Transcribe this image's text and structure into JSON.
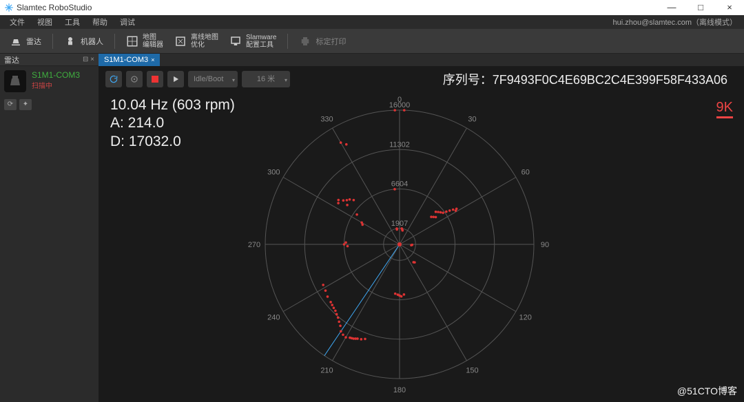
{
  "titlebar": {
    "title": "Slamtec RoboStudio"
  },
  "window_buttons": {
    "min": "—",
    "max": "□",
    "close": "×"
  },
  "menubar": {
    "items": [
      "文件",
      "视图",
      "工具",
      "帮助",
      "调试"
    ],
    "right": "hui.zhou@slamtec.com（离线模式）"
  },
  "toolbar": {
    "items": [
      {
        "icon": "radar-icon",
        "label": "雷达"
      },
      {
        "icon": "robot-icon",
        "label": "机器人"
      },
      {
        "icon": "map-editor-icon",
        "label1": "地图",
        "label2": "编辑器"
      },
      {
        "icon": "offline-map-icon",
        "label1": "离线地图",
        "label2": "优化"
      },
      {
        "icon": "slamware-icon",
        "label1": "Slamware",
        "label2": "配置工具"
      },
      {
        "icon": "print-icon",
        "label": "标定打印"
      }
    ]
  },
  "left": {
    "header": "雷达",
    "header_close": "⊟ ×",
    "device": {
      "name": "S1M1-COM3",
      "status": "扫描中"
    },
    "btns": [
      "⟳",
      "✦"
    ]
  },
  "tab": {
    "label": "S1M1-COM3",
    "close": "×"
  },
  "controls": {
    "dropdown1": "Idle/Boot",
    "range": "16 米"
  },
  "serial": {
    "label": "序列号：",
    "value": "7F9493F0C4E69BC2C4E399F58F433A06"
  },
  "stats": {
    "freq": "10.04 Hz (603 rpm)",
    "a": "A: 214.0",
    "d": "D: 17032.0"
  },
  "ninek": "9K",
  "chart_data": {
    "type": "polar-scatter",
    "title": "",
    "angle_ticks": [
      0,
      30,
      60,
      90,
      120,
      150,
      180,
      210,
      240,
      270,
      300,
      330
    ],
    "ring_values": [
      1907,
      6604,
      11302,
      16000
    ],
    "rmax": 16000,
    "scan_angle": 214,
    "points": [
      [
        350,
        1907
      ],
      [
        355,
        6604
      ],
      [
        358,
        16000
      ],
      [
        2,
        16000
      ],
      [
        330,
        14000
      ],
      [
        332,
        13500
      ],
      [
        308,
        8500
      ],
      [
        306,
        9000
      ],
      [
        304,
        8800
      ],
      [
        307,
        7800
      ],
      [
        310,
        8200
      ],
      [
        312,
        8000
      ],
      [
        314,
        7600
      ],
      [
        305,
        6200
      ],
      [
        300,
        5200
      ],
      [
        298,
        5000
      ],
      [
        270,
        6604
      ],
      [
        272,
        6400
      ],
      [
        268,
        6200
      ],
      [
        92,
        1500
      ],
      [
        94,
        1400
      ],
      [
        140,
        2800
      ],
      [
        142,
        2700
      ],
      [
        175,
        6000
      ],
      [
        178,
        6200
      ],
      [
        180,
        6100
      ],
      [
        182,
        6000
      ],
      [
        185,
        5900
      ],
      [
        200,
        12000
      ],
      [
        202,
        12200
      ],
      [
        204,
        12300
      ],
      [
        205,
        12400
      ],
      [
        206,
        12500
      ],
      [
        207,
        12550
      ],
      [
        208,
        12600
      ],
      [
        210,
        12800
      ],
      [
        212,
        12700
      ],
      [
        214,
        12500
      ],
      [
        216,
        12000
      ],
      [
        218,
        11700
      ],
      [
        220,
        11400
      ],
      [
        222,
        11200
      ],
      [
        224,
        11000
      ],
      [
        226,
        10900
      ],
      [
        228,
        10800
      ],
      [
        230,
        10700
      ],
      [
        234,
        10600
      ],
      [
        238,
        10400
      ],
      [
        242,
        10300
      ],
      [
        48,
        5800
      ],
      [
        50,
        6000
      ],
      [
        52,
        6200
      ],
      [
        54,
        6400
      ],
      [
        55,
        6800
      ],
      [
        56,
        7200
      ],
      [
        57,
        7600
      ],
      [
        58,
        8000
      ],
      [
        59,
        7800
      ],
      [
        53,
        5400
      ],
      [
        51,
        5200
      ],
      [
        49,
        5000
      ],
      [
        8,
        1907
      ],
      [
        10,
        1800
      ],
      [
        12,
        1700
      ],
      [
        350,
        1800
      ]
    ]
  },
  "watermark": "@51CTO博客"
}
